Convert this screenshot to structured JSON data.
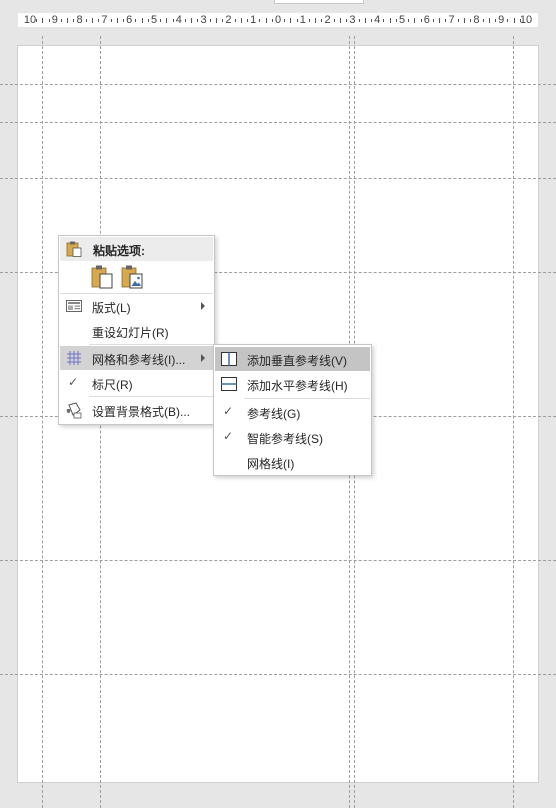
{
  "ruler": {
    "labels": [
      "10",
      "9",
      "8",
      "7",
      "6",
      "5",
      "4",
      "3",
      "2",
      "1",
      "0",
      "1",
      "2",
      "3",
      "4",
      "5",
      "6",
      "7",
      "8",
      "9",
      "10"
    ]
  },
  "context_menu": {
    "paste_header": "粘贴选项:",
    "items": [
      {
        "label": "版式(L)",
        "icon": "layout-icon",
        "submenu": true
      },
      {
        "label": "重设幻灯片(R)",
        "icon": "",
        "submenu": false
      },
      {
        "label": "网格和参考线(I)...",
        "icon": "grid-icon",
        "submenu": true,
        "highlighted": true
      },
      {
        "label": "标尺(R)",
        "icon": "checkmark-icon",
        "submenu": false,
        "checked": true
      },
      {
        "label": "设置背景格式(B)...",
        "icon": "format-background-icon",
        "submenu": false
      }
    ]
  },
  "submenu": {
    "items": [
      {
        "label": "添加垂直参考线(V)",
        "icon": "vertical-guide-icon",
        "highlighted": true
      },
      {
        "label": "添加水平参考线(H)",
        "icon": "horizontal-guide-icon"
      },
      {
        "label": "参考线(G)",
        "checked": true
      },
      {
        "label": "智能参考线(S)",
        "checked": true
      },
      {
        "label": "网格线(I)",
        "checked": false
      }
    ]
  },
  "colors": {
    "workspace": "#e6e6e6",
    "slide": "#ffffff",
    "guide": "#9e9e9e",
    "grid_icon": "#6c73c4",
    "clipboard": "#d8a84e",
    "highlight": "#d3d3d3"
  }
}
